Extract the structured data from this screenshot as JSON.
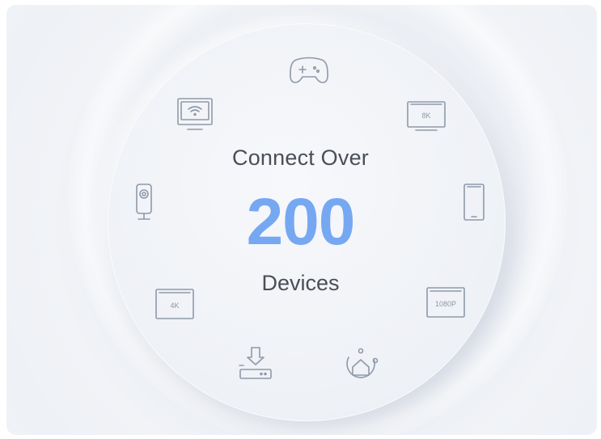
{
  "headline": {
    "line1": "Connect Over",
    "number": "200",
    "line2": "Devices"
  },
  "icons": [
    {
      "name": "gamepad-icon"
    },
    {
      "name": "8k-tv-icon",
      "label": "8K"
    },
    {
      "name": "smartphone-icon"
    },
    {
      "name": "1080p-tv-icon",
      "label": "1080P"
    },
    {
      "name": "smart-home-icon"
    },
    {
      "name": "download-device-icon"
    },
    {
      "name": "4k-tv-icon",
      "label": "4K"
    },
    {
      "name": "security-camera-icon"
    },
    {
      "name": "wifi-monitor-icon"
    }
  ],
  "colors": {
    "accent_number": "#76a8f2",
    "text": "#4a4f57",
    "icon_stroke": "#8f99a8",
    "background": "#eef1f5"
  }
}
